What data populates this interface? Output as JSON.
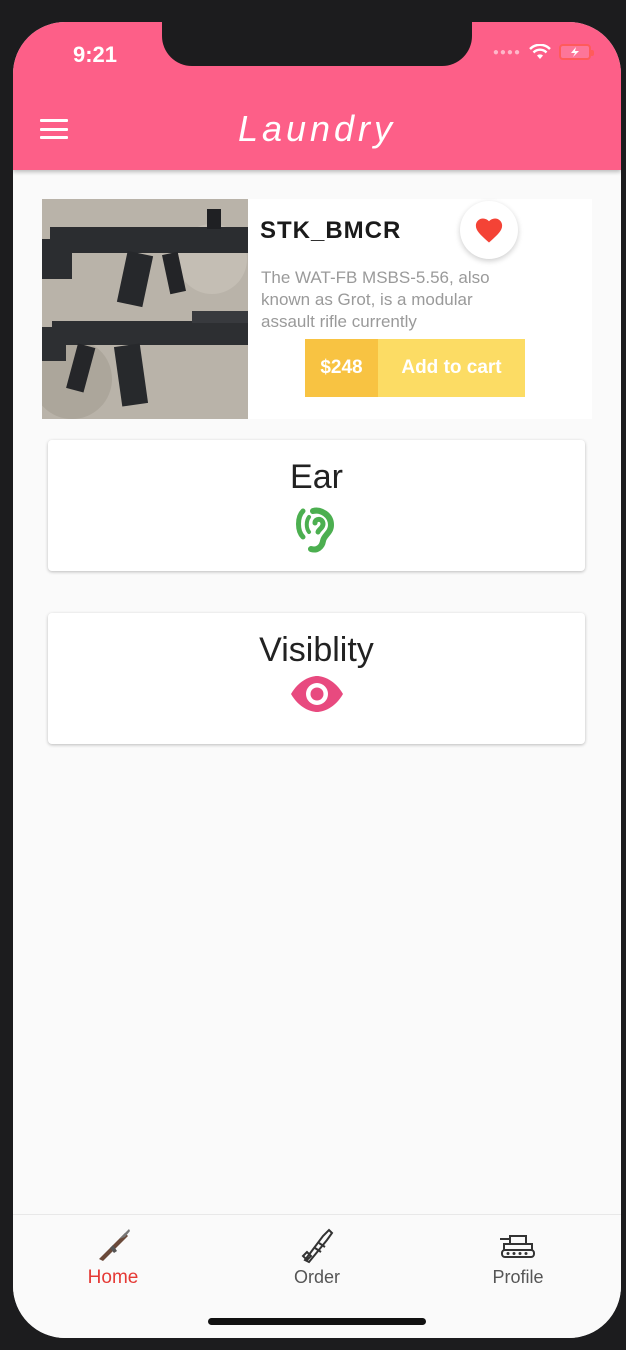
{
  "status_bar": {
    "time": "9:21"
  },
  "app_bar": {
    "title": "Laundry"
  },
  "product": {
    "name": "STK_BMCR",
    "description": "The WAT-FB MSBS-5.56, also known as Grot, is a modular assault rifle currently",
    "price": "$248",
    "add_to_cart_label": "Add to cart",
    "favorite_color": "#f44336"
  },
  "features": [
    {
      "label": "Ear",
      "icon": "ear-icon",
      "color": "#4caf50"
    },
    {
      "label": "Visiblity",
      "icon": "eye-icon",
      "color": "#e84a7f"
    }
  ],
  "bottom_nav": {
    "items": [
      {
        "label": "Home",
        "icon": "rifle-icon",
        "active": true
      },
      {
        "label": "Order",
        "icon": "rocket-icon",
        "active": false
      },
      {
        "label": "Profile",
        "icon": "tank-icon",
        "active": false
      }
    ]
  },
  "colors": {
    "primary": "#fd5f88",
    "price_bg": "#f8c342",
    "cart_bg": "#fcdc64",
    "active_nav": "#e53935"
  }
}
